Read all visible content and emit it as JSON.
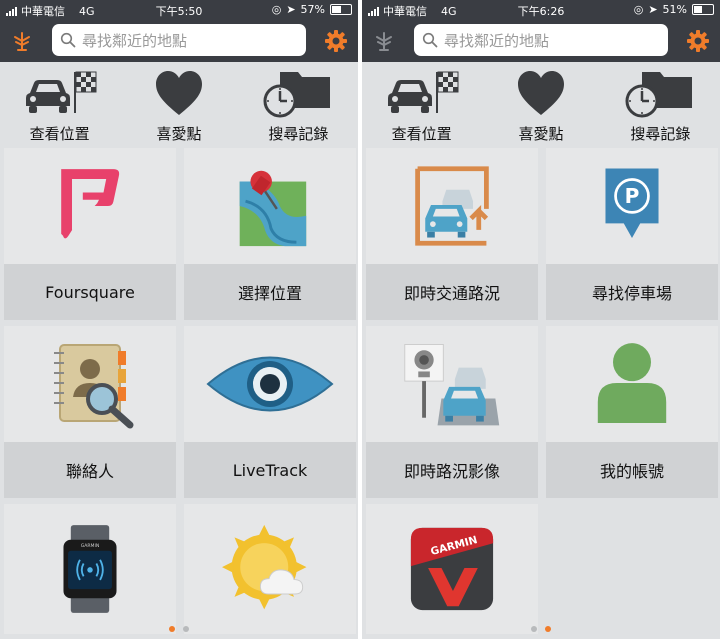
{
  "screens": [
    {
      "status": {
        "carrier": "中華電信",
        "network": "4G",
        "time": "下午5:50",
        "battery": "57%",
        "battery_level": 0.57
      },
      "search": {
        "placeholder": "尋找鄰近的地點"
      },
      "quick": [
        {
          "label": "查看位置",
          "icon": "car-flag-icon"
        },
        {
          "label": "喜愛點",
          "icon": "heart-icon"
        },
        {
          "label": "搜尋記錄",
          "icon": "history-folder-icon"
        }
      ],
      "tiles": [
        {
          "label": "Foursquare",
          "icon": "foursquare-icon"
        },
        {
          "label": "選擇位置",
          "icon": "map-pin-icon"
        },
        {
          "label": "聯絡人",
          "icon": "contacts-icon"
        },
        {
          "label": "LiveTrack",
          "icon": "eye-icon"
        },
        {
          "label": "",
          "icon": "smartwatch-icon"
        },
        {
          "label": "",
          "icon": "weather-icon"
        }
      ],
      "page_indicator": {
        "pages": 2,
        "current": 1
      }
    },
    {
      "status": {
        "carrier": "中華電信",
        "network": "4G",
        "time": "下午6:26",
        "battery": "51%",
        "battery_level": 0.51
      },
      "search": {
        "placeholder": "尋找鄰近的地點"
      },
      "quick": [
        {
          "label": "查看位置",
          "icon": "car-flag-icon"
        },
        {
          "label": "喜愛點",
          "icon": "heart-icon"
        },
        {
          "label": "搜尋記錄",
          "icon": "history-folder-icon"
        }
      ],
      "tiles": [
        {
          "label": "即時交通路況",
          "icon": "traffic-icon"
        },
        {
          "label": "尋找停車場",
          "icon": "parking-icon"
        },
        {
          "label": "即時路況影像",
          "icon": "traffic-camera-icon"
        },
        {
          "label": "我的帳號",
          "icon": "account-icon"
        },
        {
          "label": "",
          "icon": "garmin-app-icon"
        }
      ],
      "page_indicator": {
        "pages": 2,
        "current": 2
      }
    }
  ],
  "colors": {
    "accent": "#f07c2a",
    "bar": "#3a3d43",
    "tile": "#e6e7e8",
    "tile_label": "#d0d2d4"
  },
  "app_logo_text": "GARMIN"
}
